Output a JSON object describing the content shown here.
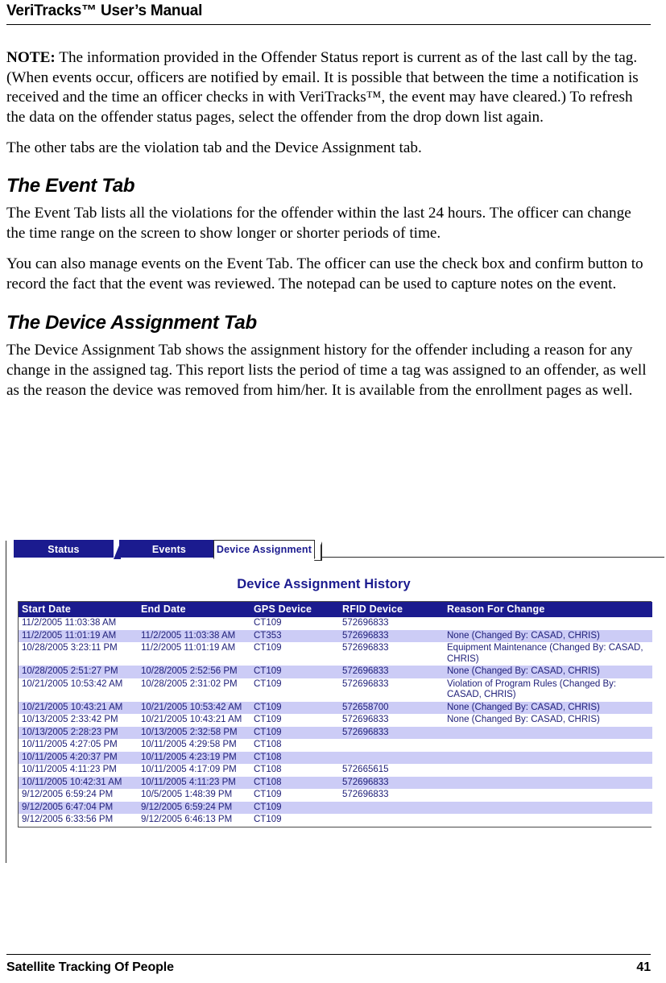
{
  "header": {
    "title": "VeriTracks™ User’s Manual"
  },
  "body": {
    "note_label": "NOTE:",
    "note_text": "  The information provided in the Offender Status report is current as of the last call by the tag.  (When events occur, officers are notified by email.  It is possible that between the time a notification is received and the time an officer checks in with VeriTracks™, the event may have cleared.)  To refresh the data on the offender status pages, select the offender from the drop down list again.",
    "other_tabs": "The other tabs are the violation tab and the Device Assignment tab.",
    "event_tab_heading": "The Event Tab",
    "event_tab_p1": "The Event Tab lists all the violations for the offender within the last 24 hours.  The officer can change the time range on the screen to show longer or shorter periods of time.",
    "event_tab_p2": "You can also manage events on the Event Tab.  The officer can use the check box and confirm button to record the fact that the event was reviewed.  The notepad can be used to capture notes on the event.",
    "device_tab_heading": "The Device Assignment Tab",
    "device_tab_p1": "The Device Assignment Tab shows the assignment history for the offender including a reason for any change in the assigned tag.  This report lists the period of time a tag was assigned to an offender, as well as the reason the device was removed from him/her.  It is available from the enrollment pages as well."
  },
  "screenshot": {
    "tabs": [
      {
        "label": "Status",
        "active": false
      },
      {
        "label": "Events",
        "active": false
      },
      {
        "label": "Device Assignment",
        "active": true
      }
    ],
    "report_title": "Device Assignment History",
    "colors": {
      "tab_blue": "#1b1b8f",
      "header_blue": "#1b1b8f",
      "row_alt": "#ccccf6",
      "text_blue": "#20207a"
    },
    "table": {
      "columns": [
        "Start Date",
        "End Date",
        "GPS Device",
        "RFID Device",
        "Reason For Change"
      ],
      "rows": [
        {
          "start": "11/2/2005 11:03:38 AM",
          "end": "",
          "gps": "CT109",
          "rfid": "572696833",
          "reason": ""
        },
        {
          "start": "11/2/2005 11:01:19 AM",
          "end": "11/2/2005 11:03:38 AM",
          "gps": "CT353",
          "rfid": "572696833",
          "reason": "None (Changed By: CASAD, CHRIS)"
        },
        {
          "start": "10/28/2005 3:23:11 PM",
          "end": "11/2/2005 11:01:19 AM",
          "gps": "CT109",
          "rfid": "572696833",
          "reason": "Equipment Maintenance (Changed By: CASAD, CHRIS)"
        },
        {
          "start": "10/28/2005 2:51:27 PM",
          "end": "10/28/2005 2:52:56 PM",
          "gps": "CT109",
          "rfid": "572696833",
          "reason": "None (Changed By: CASAD, CHRIS)"
        },
        {
          "start": "10/21/2005 10:53:42 AM",
          "end": "10/28/2005 2:31:02 PM",
          "gps": "CT109",
          "rfid": "572696833",
          "reason": "Violation of Program Rules (Changed By: CASAD, CHRIS)"
        },
        {
          "start": "10/21/2005 10:43:21 AM",
          "end": "10/21/2005 10:53:42 AM",
          "gps": "CT109",
          "rfid": "572658700",
          "reason": "None (Changed By: CASAD, CHRIS)"
        },
        {
          "start": "10/13/2005 2:33:42 PM",
          "end": "10/21/2005 10:43:21 AM",
          "gps": "CT109",
          "rfid": "572696833",
          "reason": "None (Changed By: CASAD, CHRIS)"
        },
        {
          "start": "10/13/2005 2:28:23 PM",
          "end": "10/13/2005 2:32:58 PM",
          "gps": "CT109",
          "rfid": "572696833",
          "reason": ""
        },
        {
          "start": "10/11/2005 4:27:05 PM",
          "end": "10/11/2005 4:29:58 PM",
          "gps": "CT108",
          "rfid": "",
          "reason": ""
        },
        {
          "start": "10/11/2005 4:20:37 PM",
          "end": "10/11/2005 4:23:19 PM",
          "gps": "CT108",
          "rfid": "",
          "reason": ""
        },
        {
          "start": "10/11/2005 4:11:23 PM",
          "end": "10/11/2005 4:17:09 PM",
          "gps": "CT108",
          "rfid": "572665615",
          "reason": ""
        },
        {
          "start": "10/11/2005 10:42:31 AM",
          "end": "10/11/2005 4:11:23 PM",
          "gps": "CT108",
          "rfid": "572696833",
          "reason": ""
        },
        {
          "start": "9/12/2005 6:59:24 PM",
          "end": "10/5/2005 1:48:39 PM",
          "gps": "CT109",
          "rfid": "572696833",
          "reason": ""
        },
        {
          "start": "9/12/2005 6:47:04 PM",
          "end": "9/12/2005 6:59:24 PM",
          "gps": "CT109",
          "rfid": "",
          "reason": ""
        },
        {
          "start": "9/12/2005 6:33:56 PM",
          "end": "9/12/2005 6:46:13 PM",
          "gps": "CT109",
          "rfid": "",
          "reason": ""
        }
      ]
    }
  },
  "footer": {
    "company": "Satellite Tracking Of People",
    "page_number": "41"
  }
}
